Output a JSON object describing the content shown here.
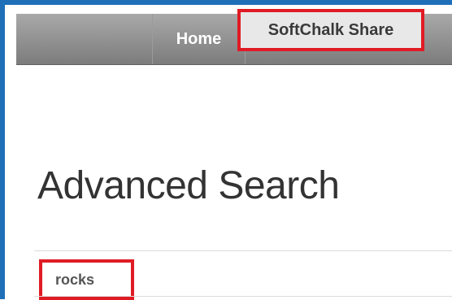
{
  "nav": {
    "home_label": "Home",
    "share_label": "SoftChalk Share"
  },
  "main": {
    "page_title": "Advanced Search",
    "search_term": "rocks"
  },
  "colors": {
    "frame_border": "#1e6fb8",
    "highlight": "#e01b24",
    "nav_background": "#8e8e8e",
    "active_tab_background": "#e8e8e8"
  }
}
